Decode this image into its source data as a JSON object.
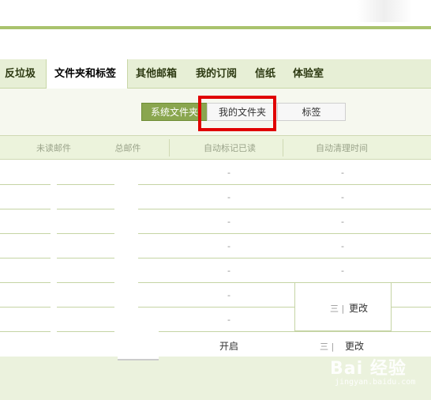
{
  "nav": {
    "tabs": [
      {
        "label": "反垃圾"
      },
      {
        "label": "文件夹和标签"
      },
      {
        "label": "其他邮箱"
      },
      {
        "label": "我的订阅"
      },
      {
        "label": "信纸"
      },
      {
        "label": "体验室"
      }
    ],
    "active_tab": "文件夹和标签"
  },
  "subnav": {
    "buttons": [
      {
        "label": "系统文件夹"
      },
      {
        "label": "我的文件夹"
      },
      {
        "label": "标签"
      }
    ],
    "selected": "系统文件夹",
    "highlighted": "我的文件夹"
  },
  "table": {
    "headers": [
      "未读邮件",
      "总邮件",
      "自动标记已读",
      "自动清理时间"
    ],
    "rows": [
      {
        "auto_read": "-",
        "auto_clean": "-"
      },
      {
        "auto_read": "-",
        "auto_clean": "-"
      },
      {
        "auto_read": "-",
        "auto_clean": "-"
      },
      {
        "auto_read": "-",
        "auto_clean": "-"
      },
      {
        "auto_read": "-",
        "auto_clean": "-"
      },
      {
        "auto_read": "-",
        "auto_clean": ""
      },
      {
        "auto_read": "-",
        "auto_clean": ""
      },
      {
        "auto_read": "开启",
        "auto_clean": ""
      }
    ],
    "merged_cell_prefix": "三 |",
    "merged_cell_action": "更改",
    "last_row_prefix": "三 |",
    "last_row_action": "更改"
  },
  "watermark": {
    "text": "Bai 经验",
    "sub": "jingyan.baidu.com"
  },
  "colors": {
    "accent_green": "#8aa64f",
    "nav_bg": "#e7efd6",
    "highlight_red": "#e00000"
  }
}
